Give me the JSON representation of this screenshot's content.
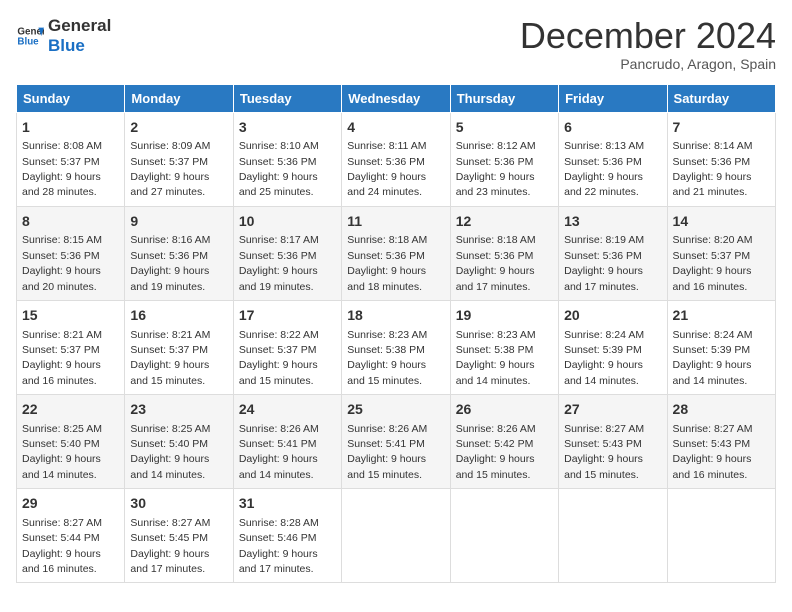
{
  "logo": {
    "line1": "General",
    "line2": "Blue"
  },
  "title": "December 2024",
  "subtitle": "Pancrudo, Aragon, Spain",
  "days_header": [
    "Sunday",
    "Monday",
    "Tuesday",
    "Wednesday",
    "Thursday",
    "Friday",
    "Saturday"
  ],
  "weeks": [
    [
      {
        "day": "1",
        "sunrise": "8:08 AM",
        "sunset": "5:37 PM",
        "daylight": "9 hours and 28 minutes."
      },
      {
        "day": "2",
        "sunrise": "8:09 AM",
        "sunset": "5:37 PM",
        "daylight": "9 hours and 27 minutes."
      },
      {
        "day": "3",
        "sunrise": "8:10 AM",
        "sunset": "5:36 PM",
        "daylight": "9 hours and 25 minutes."
      },
      {
        "day": "4",
        "sunrise": "8:11 AM",
        "sunset": "5:36 PM",
        "daylight": "9 hours and 24 minutes."
      },
      {
        "day": "5",
        "sunrise": "8:12 AM",
        "sunset": "5:36 PM",
        "daylight": "9 hours and 23 minutes."
      },
      {
        "day": "6",
        "sunrise": "8:13 AM",
        "sunset": "5:36 PM",
        "daylight": "9 hours and 22 minutes."
      },
      {
        "day": "7",
        "sunrise": "8:14 AM",
        "sunset": "5:36 PM",
        "daylight": "9 hours and 21 minutes."
      }
    ],
    [
      {
        "day": "8",
        "sunrise": "8:15 AM",
        "sunset": "5:36 PM",
        "daylight": "9 hours and 20 minutes."
      },
      {
        "day": "9",
        "sunrise": "8:16 AM",
        "sunset": "5:36 PM",
        "daylight": "9 hours and 19 minutes."
      },
      {
        "day": "10",
        "sunrise": "8:17 AM",
        "sunset": "5:36 PM",
        "daylight": "9 hours and 19 minutes."
      },
      {
        "day": "11",
        "sunrise": "8:18 AM",
        "sunset": "5:36 PM",
        "daylight": "9 hours and 18 minutes."
      },
      {
        "day": "12",
        "sunrise": "8:18 AM",
        "sunset": "5:36 PM",
        "daylight": "9 hours and 17 minutes."
      },
      {
        "day": "13",
        "sunrise": "8:19 AM",
        "sunset": "5:36 PM",
        "daylight": "9 hours and 17 minutes."
      },
      {
        "day": "14",
        "sunrise": "8:20 AM",
        "sunset": "5:37 PM",
        "daylight": "9 hours and 16 minutes."
      }
    ],
    [
      {
        "day": "15",
        "sunrise": "8:21 AM",
        "sunset": "5:37 PM",
        "daylight": "9 hours and 16 minutes."
      },
      {
        "day": "16",
        "sunrise": "8:21 AM",
        "sunset": "5:37 PM",
        "daylight": "9 hours and 15 minutes."
      },
      {
        "day": "17",
        "sunrise": "8:22 AM",
        "sunset": "5:37 PM",
        "daylight": "9 hours and 15 minutes."
      },
      {
        "day": "18",
        "sunrise": "8:23 AM",
        "sunset": "5:38 PM",
        "daylight": "9 hours and 15 minutes."
      },
      {
        "day": "19",
        "sunrise": "8:23 AM",
        "sunset": "5:38 PM",
        "daylight": "9 hours and 14 minutes."
      },
      {
        "day": "20",
        "sunrise": "8:24 AM",
        "sunset": "5:39 PM",
        "daylight": "9 hours and 14 minutes."
      },
      {
        "day": "21",
        "sunrise": "8:24 AM",
        "sunset": "5:39 PM",
        "daylight": "9 hours and 14 minutes."
      }
    ],
    [
      {
        "day": "22",
        "sunrise": "8:25 AM",
        "sunset": "5:40 PM",
        "daylight": "9 hours and 14 minutes."
      },
      {
        "day": "23",
        "sunrise": "8:25 AM",
        "sunset": "5:40 PM",
        "daylight": "9 hours and 14 minutes."
      },
      {
        "day": "24",
        "sunrise": "8:26 AM",
        "sunset": "5:41 PM",
        "daylight": "9 hours and 14 minutes."
      },
      {
        "day": "25",
        "sunrise": "8:26 AM",
        "sunset": "5:41 PM",
        "daylight": "9 hours and 15 minutes."
      },
      {
        "day": "26",
        "sunrise": "8:26 AM",
        "sunset": "5:42 PM",
        "daylight": "9 hours and 15 minutes."
      },
      {
        "day": "27",
        "sunrise": "8:27 AM",
        "sunset": "5:43 PM",
        "daylight": "9 hours and 15 minutes."
      },
      {
        "day": "28",
        "sunrise": "8:27 AM",
        "sunset": "5:43 PM",
        "daylight": "9 hours and 16 minutes."
      }
    ],
    [
      {
        "day": "29",
        "sunrise": "8:27 AM",
        "sunset": "5:44 PM",
        "daylight": "9 hours and 16 minutes."
      },
      {
        "day": "30",
        "sunrise": "8:27 AM",
        "sunset": "5:45 PM",
        "daylight": "9 hours and 17 minutes."
      },
      {
        "day": "31",
        "sunrise": "8:28 AM",
        "sunset": "5:46 PM",
        "daylight": "9 hours and 17 minutes."
      },
      null,
      null,
      null,
      null
    ]
  ],
  "labels": {
    "sunrise": "Sunrise:",
    "sunset": "Sunset:",
    "daylight": "Daylight:"
  }
}
